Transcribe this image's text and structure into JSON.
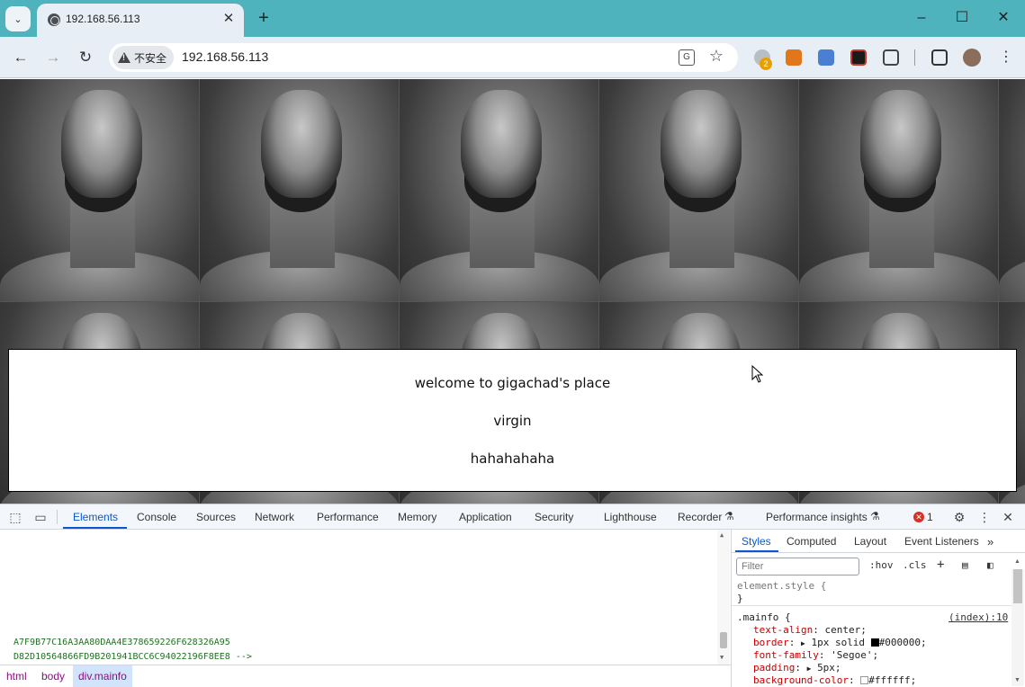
{
  "browser": {
    "tab_title": "192.168.56.113",
    "new_tab_label": "+",
    "security_label": "不安全",
    "url": "192.168.56.113",
    "extension_badge": "2"
  },
  "page": {
    "welcome_text": "welcome to gigachad's place",
    "line2": "virgin",
    "line3": "hahahahaha"
  },
  "devtools": {
    "tabs": [
      "Elements",
      "Console",
      "Sources",
      "Network",
      "Performance",
      "Memory",
      "Application",
      "Security",
      "Lighthouse",
      "Recorder",
      "Performance insights"
    ],
    "error_count": "1",
    "dom_comment_line1": "A7F9B77C16A3AA80DAA4E378659226F628326A95",
    "dom_comment_line2": "D82D10564866FD9B201941BCC6C94022196F8EE8 -->",
    "breadcrumbs": [
      "html",
      "body",
      "div.mainfo"
    ],
    "styles_tabs": [
      "Styles",
      "Computed",
      "Layout",
      "Event Listeners"
    ],
    "filter_placeholder": "Filter",
    "hov_label": ":hov",
    "cls_label": ".cls",
    "element_style_open": "element.style {",
    "element_style_close": "}",
    "rule_selector": ".mainfo {",
    "rule_source": "(index):10",
    "declarations": [
      {
        "prop": "text-align",
        "value": "center;"
      },
      {
        "prop": "border",
        "value": "1px solid",
        "swatch": "#000000",
        "value_after": "#000000;"
      },
      {
        "prop": "font-family",
        "value": "'Segoe';"
      },
      {
        "prop": "padding",
        "value": "5px;"
      },
      {
        "prop": "background-color",
        "value": "#ffffff;"
      }
    ]
  },
  "colors": {
    "tabstrip": "#4fb3bd",
    "toolbar": "#e8eef6",
    "devtools_accent": "#0b57d0",
    "comment": "#236e25",
    "error": "#d93025"
  },
  "icons": [
    "tab-search-icon",
    "favicon-icon",
    "close-icon",
    "back-icon",
    "forward-icon",
    "reload-icon",
    "warning-icon",
    "translate-icon",
    "star-icon",
    "extensions-icon",
    "sidebar-icon",
    "profile-avatar",
    "menu-icon",
    "inspect-icon",
    "device-icon",
    "settings-icon",
    "more-icon"
  ]
}
